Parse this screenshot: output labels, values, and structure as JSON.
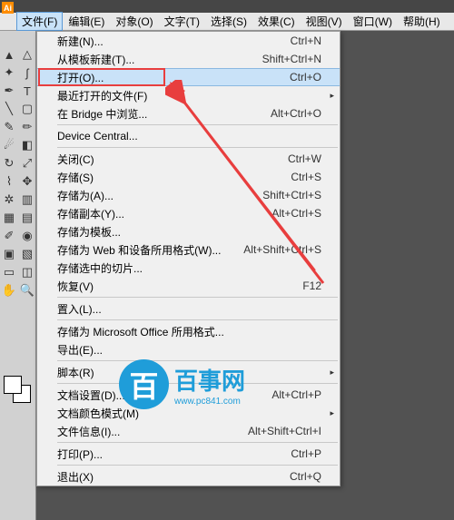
{
  "app_icon_text": "Ai",
  "menubar": {
    "file": "文件(F)",
    "edit": "编辑(E)",
    "object": "对象(O)",
    "text": "文字(T)",
    "select": "选择(S)",
    "effect": "效果(C)",
    "view": "视图(V)",
    "window": "窗口(W)",
    "help": "帮助(H)"
  },
  "file_menu": {
    "new": {
      "label": "新建(N)...",
      "shortcut": "Ctrl+N"
    },
    "new_template": {
      "label": "从模板新建(T)...",
      "shortcut": "Shift+Ctrl+N"
    },
    "open": {
      "label": "打开(O)...",
      "shortcut": "Ctrl+O"
    },
    "recent": {
      "label": "最近打开的文件(F)",
      "shortcut": ""
    },
    "bridge": {
      "label": "在 Bridge 中浏览...",
      "shortcut": "Alt+Ctrl+O"
    },
    "device_central": {
      "label": "Device Central...",
      "shortcut": ""
    },
    "close": {
      "label": "关闭(C)",
      "shortcut": "Ctrl+W"
    },
    "save": {
      "label": "存储(S)",
      "shortcut": "Ctrl+S"
    },
    "save_as": {
      "label": "存储为(A)...",
      "shortcut": "Shift+Ctrl+S"
    },
    "save_copy": {
      "label": "存储副本(Y)...",
      "shortcut": "Alt+Ctrl+S"
    },
    "save_template": {
      "label": "存储为模板...",
      "shortcut": ""
    },
    "save_web": {
      "label": "存储为 Web 和设备所用格式(W)...",
      "shortcut": "Alt+Shift+Ctrl+S"
    },
    "save_slices": {
      "label": "存储选中的切片...",
      "shortcut": ""
    },
    "revert": {
      "label": "恢复(V)",
      "shortcut": "F12"
    },
    "place": {
      "label": "置入(L)...",
      "shortcut": ""
    },
    "save_ms": {
      "label": "存储为 Microsoft Office 所用格式...",
      "shortcut": ""
    },
    "export": {
      "label": "导出(E)...",
      "shortcut": ""
    },
    "scripts": {
      "label": "脚本(R)",
      "shortcut": ""
    },
    "doc_setup": {
      "label": "文档设置(D)...",
      "shortcut": "Alt+Ctrl+P"
    },
    "color_mode": {
      "label": "文档颜色模式(M)",
      "shortcut": ""
    },
    "file_info": {
      "label": "文件信息(I)...",
      "shortcut": "Alt+Shift+Ctrl+I"
    },
    "print": {
      "label": "打印(P)...",
      "shortcut": "Ctrl+P"
    },
    "quit": {
      "label": "退出(X)",
      "shortcut": "Ctrl+Q"
    }
  },
  "watermark": {
    "icon": "百",
    "text": "百事网",
    "url": "www.pc841.com"
  },
  "arrow_color": "#e83e3e"
}
